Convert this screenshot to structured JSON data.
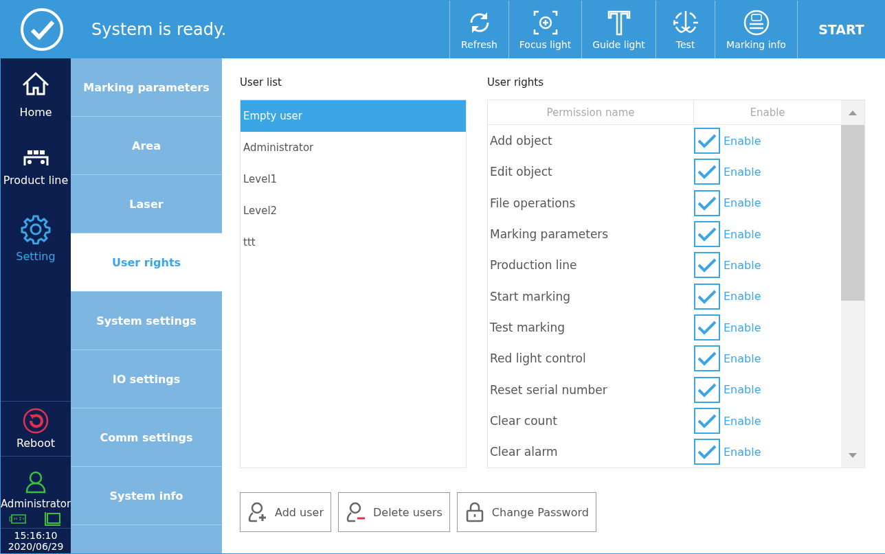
{
  "header": {
    "status": "System is ready.",
    "tools": [
      {
        "kind": "refresh",
        "label": "Refresh"
      },
      {
        "kind": "focus",
        "label": "Focus light"
      },
      {
        "kind": "guide",
        "label": "Guide light"
      },
      {
        "kind": "test",
        "label": "Test"
      },
      {
        "kind": "info",
        "label": "Marking info"
      }
    ],
    "start": "START"
  },
  "nav": {
    "items": [
      {
        "kind": "home",
        "label": "Home",
        "selected": false
      },
      {
        "kind": "line",
        "label": "Product line",
        "selected": false
      },
      {
        "kind": "setting",
        "label": "Setting",
        "selected": true
      }
    ],
    "reboot": "Reboot",
    "user": "Administrator",
    "time": "15:16:10",
    "date": "2020/06/29"
  },
  "subnav": [
    {
      "label": "Marking parameters",
      "selected": false
    },
    {
      "label": "Area",
      "selected": false
    },
    {
      "label": "Laser",
      "selected": false
    },
    {
      "label": "User rights",
      "selected": true
    },
    {
      "label": "System settings",
      "selected": false
    },
    {
      "label": "IO settings",
      "selected": false
    },
    {
      "label": "Comm settings",
      "selected": false
    },
    {
      "label": "System info",
      "selected": false
    }
  ],
  "user_list": {
    "title": "User list",
    "items": [
      {
        "label": "Empty user",
        "selected": true
      },
      {
        "label": "Administrator",
        "selected": false
      },
      {
        "label": "Level1",
        "selected": false
      },
      {
        "label": "Level2",
        "selected": false
      },
      {
        "label": "ttt",
        "selected": false
      }
    ]
  },
  "user_rights": {
    "title": "User rights",
    "columns": [
      "Permission name",
      "Enable"
    ],
    "rows": [
      {
        "name": "Add object",
        "checked": true,
        "label": "Enable"
      },
      {
        "name": "Edit object",
        "checked": true,
        "label": "Enable"
      },
      {
        "name": "File operations",
        "checked": true,
        "label": "Enable"
      },
      {
        "name": "Marking parameters",
        "checked": true,
        "label": "Enable"
      },
      {
        "name": "Production line",
        "checked": true,
        "label": "Enable"
      },
      {
        "name": "Start marking",
        "checked": true,
        "label": "Enable"
      },
      {
        "name": "Test marking",
        "checked": true,
        "label": "Enable"
      },
      {
        "name": "Red light control",
        "checked": true,
        "label": "Enable"
      },
      {
        "name": "Reset serial number",
        "checked": true,
        "label": "Enable"
      },
      {
        "name": "Clear count",
        "checked": true,
        "label": "Enable"
      },
      {
        "name": "Clear alarm",
        "checked": true,
        "label": "Enable"
      }
    ]
  },
  "actions": [
    {
      "kind": "add",
      "label": "Add user"
    },
    {
      "kind": "delete",
      "label": "Delete users"
    },
    {
      "kind": "password",
      "label": "Change Password"
    }
  ]
}
